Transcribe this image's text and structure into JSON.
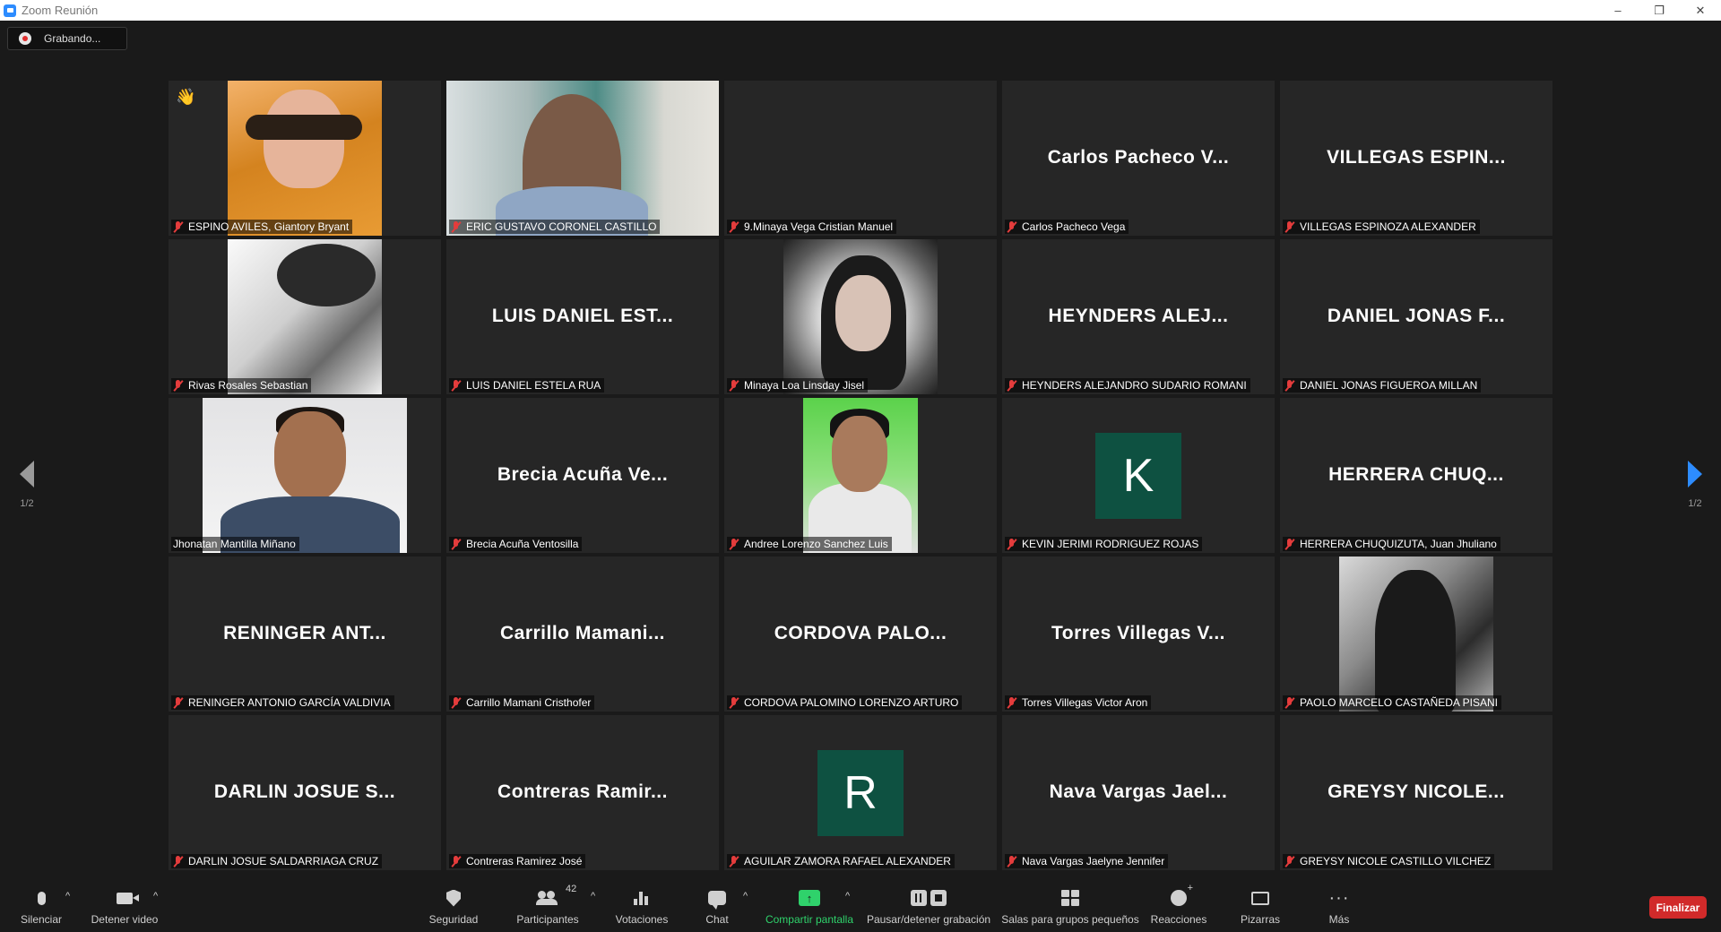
{
  "window": {
    "title": "Zoom Reunión",
    "controls": [
      "–",
      "❐",
      "✕"
    ]
  },
  "recording": {
    "label": "Grabando..."
  },
  "nav": {
    "page_indicator": "1/2"
  },
  "tiles": [
    {
      "name": "ESPINO AVILES, Giantory Bryant",
      "muted": true,
      "photo": "warm",
      "reaction": "👋"
    },
    {
      "name": "ERIC GUSTAVO CORONEL CASTILLO",
      "muted": true,
      "photo": "room",
      "active": true
    },
    {
      "name": "9.Minaya Vega Cristian Manuel",
      "muted": true
    },
    {
      "name": "Carlos Pacheco Vega",
      "muted": true,
      "display": "Carlos Pacheco V..."
    },
    {
      "name": "VILLEGAS ESPINOZA ALEXANDER",
      "muted": true,
      "display": "VILLEGAS ESPIN..."
    },
    {
      "name": "Rivas Rosales Sebastian",
      "muted": true,
      "photo": "bw"
    },
    {
      "name": "LUIS DANIEL ESTELA RUA",
      "muted": true,
      "display": "LUIS DANIEL EST..."
    },
    {
      "name": "Minaya Loa Linsday Jisel",
      "muted": true,
      "photo": "girl"
    },
    {
      "name": "HEYNDERS ALEJANDRO SUDARIO ROMANI",
      "muted": true,
      "display": "HEYNDERS ALEJ..."
    },
    {
      "name": "DANIEL JONAS FIGUEROA MILLAN",
      "muted": true,
      "display": "DANIEL JONAS F..."
    },
    {
      "name": "Jhonatan Mantilla Miñano",
      "muted": false,
      "photo": "man"
    },
    {
      "name": "Brecia Acuña Ventosilla",
      "muted": true,
      "display": "Brecia Acuña Ve..."
    },
    {
      "name": "Andree Lorenzo Sanchez Luis",
      "muted": true,
      "photo": "green"
    },
    {
      "name": "KEVIN JERIMI RODRIGUEZ ROJAS",
      "muted": true,
      "avatar": "K"
    },
    {
      "name": "HERRERA CHUQUIZUTA, Juan Jhuliano",
      "muted": true,
      "display": "HERRERA CHUQ..."
    },
    {
      "name": "RENINGER ANTONIO GARCÍA VALDIVIA",
      "muted": true,
      "display": "RENINGER ANT..."
    },
    {
      "name": "Carrillo Mamani Cristhofer",
      "muted": true,
      "display": "Carrillo Mamani..."
    },
    {
      "name": "CORDOVA PALOMINO LORENZO ARTURO",
      "muted": true,
      "display": "CORDOVA PALO..."
    },
    {
      "name": "Torres Villegas Victor Aron",
      "muted": true,
      "display": "Torres Villegas V..."
    },
    {
      "name": "PAOLO MARCELO CASTAÑEDA PISANI",
      "muted": true,
      "photo": "dark"
    },
    {
      "name": "DARLIN JOSUE SALDARRIAGA CRUZ",
      "muted": true,
      "display": "DARLIN JOSUE S..."
    },
    {
      "name": "Contreras Ramirez José",
      "muted": true,
      "display": "Contreras Ramir..."
    },
    {
      "name": "AGUILAR ZAMORA RAFAEL ALEXANDER",
      "muted": true,
      "avatar": "R"
    },
    {
      "name": "Nava Vargas Jaelyne Jennifer",
      "muted": true,
      "display": "Nava Vargas Jael..."
    },
    {
      "name": "GREYSY NICOLE CASTILLO VILCHEZ",
      "muted": true,
      "display": "GREYSY NICOLE..."
    }
  ],
  "toolbar": {
    "mute": "Silenciar",
    "video": "Detener video",
    "security": "Seguridad",
    "participants": "Participantes",
    "participant_count": "42",
    "polls": "Votaciones",
    "chat": "Chat",
    "share": "Compartir pantalla",
    "record": "Pausar/detener grabación",
    "breakout": "Salas para grupos pequeños",
    "reactions": "Reacciones",
    "whiteboards": "Pizarras",
    "more": "Más",
    "end": "Finalizar",
    "caret": "^",
    "share_arrow": "↑",
    "more_glyph": "···"
  },
  "colors": {
    "active_speaker_border": "#c7dd5a",
    "avatar_bg": "#0e5141",
    "share_green": "#2fd26b",
    "end_red": "#d12a2a",
    "nav_arrow_blue": "#2d8cff"
  }
}
